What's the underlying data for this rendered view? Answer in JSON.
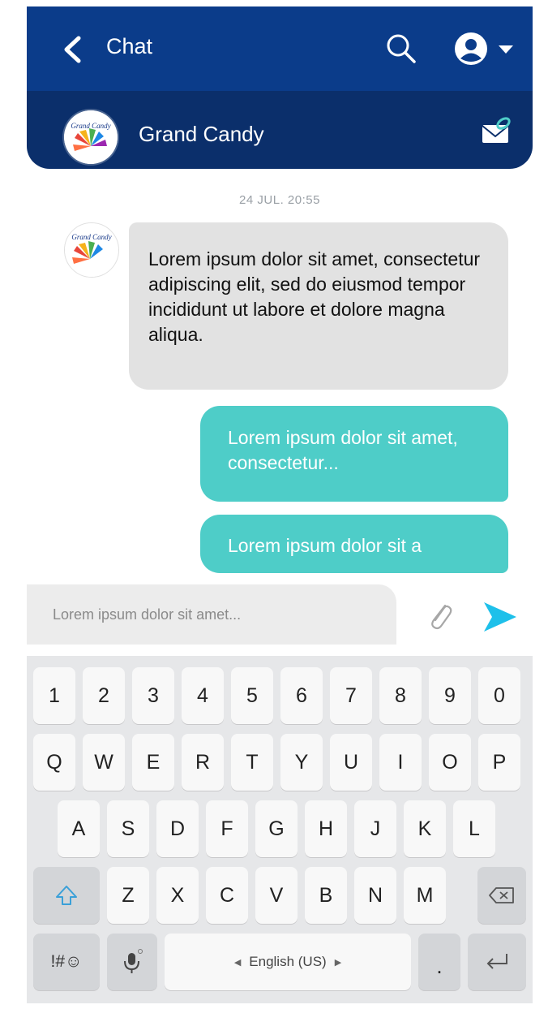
{
  "header": {
    "title": "Chat",
    "contact_name": "Grand Candy",
    "avatar_text": "Grand Candy"
  },
  "messages": {
    "timestamp": "24 JUL. 20:55",
    "incoming": "Lorem ipsum dolor sit amet, consectetur adipiscing elit, sed do eiusmod tempor incididunt ut labore et dolore magna aliqua.",
    "outgoing_1": "Lorem ipsum dolor sit amet, consectetur...",
    "outgoing_2": "Lorem ipsum dolor sit a"
  },
  "composer": {
    "placeholder": "Lorem ipsum dolor sit amet..."
  },
  "keyboard": {
    "row_numbers": [
      "1",
      "2",
      "3",
      "4",
      "5",
      "6",
      "7",
      "8",
      "9",
      "0"
    ],
    "row_top": [
      "Q",
      "W",
      "E",
      "R",
      "T",
      "Y",
      "U",
      "I",
      "O",
      "P"
    ],
    "row_home": [
      "A",
      "S",
      "D",
      "F",
      "G",
      "H",
      "J",
      "K",
      "L"
    ],
    "row_bottom": [
      "Z",
      "X",
      "C",
      "V",
      "B",
      "N",
      "M"
    ],
    "symbols_label": "!#☺",
    "space_label": "English (US)",
    "period_label": "."
  },
  "colors": {
    "header_top": "#0b3c8a",
    "header_sub": "#0b2f6b",
    "bubble_in": "#e2e2e2",
    "bubble_out": "#4ecdc8",
    "send": "#1ec0ea"
  },
  "icons": {
    "back": "chevron-left-icon",
    "search": "search-icon",
    "account": "user-circle-icon",
    "mail": "mail-attachment-icon",
    "attach": "paperclip-icon",
    "send": "send-icon",
    "shift": "shift-arrow-icon",
    "backspace": "backspace-icon",
    "mic": "microphone-icon",
    "enter": "enter-icon"
  }
}
